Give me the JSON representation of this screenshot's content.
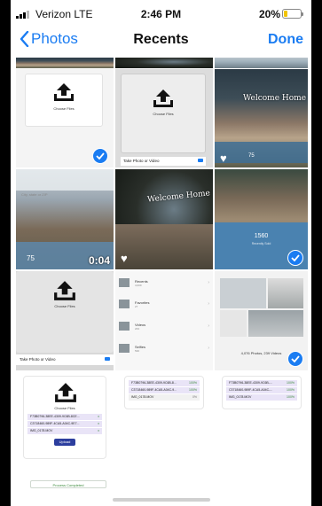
{
  "status_bar": {
    "carrier": "Verizon LTE",
    "time": "2:46 PM",
    "battery_percent": "20%",
    "battery_level": 0.2,
    "battery_color": "#f2c400"
  },
  "nav": {
    "back_label": "Photos",
    "title": "Recents",
    "done_label": "Done",
    "accent_color": "#1a7cf2"
  },
  "thumbnails": {
    "choose_files_label": "Choose Files",
    "sign_text": "Welcome Home",
    "take_photo_label": "Take Photo or Video",
    "video_duration": "0:04",
    "house_number": "1560",
    "house_sub": "Recently Sold",
    "big_number": "75",
    "search_hint": "City, state or ZIP"
  },
  "albums_sheet": {
    "items": [
      {
        "label": "Recents",
        "count": "4,009"
      },
      {
        "label": "Favorites",
        "count": "27"
      },
      {
        "label": "Videos",
        "count": "233"
      },
      {
        "label": "Selfies",
        "count": "530"
      }
    ]
  },
  "photos_footer": {
    "summary": "4,076 Photos, 239 Videos"
  },
  "upload_panel": {
    "choose_files_label": "Choose Files",
    "files": [
      {
        "name": "F73B0796-38EE-4309-9C6B-8CE..."
      },
      {
        "name": "C3718460-989F-4CA5-A04C-9E7..."
      },
      {
        "name": "IMG_0178.MOV"
      }
    ],
    "upload_button": "Upload",
    "process_status": "Process Completed"
  },
  "progress_panel_1": {
    "files": [
      {
        "name": "F73B0796-38EE-4309-9C6B-8...",
        "pct": "100%"
      },
      {
        "name": "C3718460-989F-4CA5-A04C-9...",
        "pct": "100%"
      },
      {
        "name": "IMG_0178.MOV",
        "pct": "0%"
      }
    ]
  },
  "progress_panel_2": {
    "files": [
      {
        "name": "F73B0796-38EE-4309-9C6B-...",
        "pct": "100%"
      },
      {
        "name": "C3718460-989F-4CA5-A04C-...",
        "pct": "100%"
      },
      {
        "name": "IMG_0178.MOV",
        "pct": "100%"
      }
    ]
  }
}
